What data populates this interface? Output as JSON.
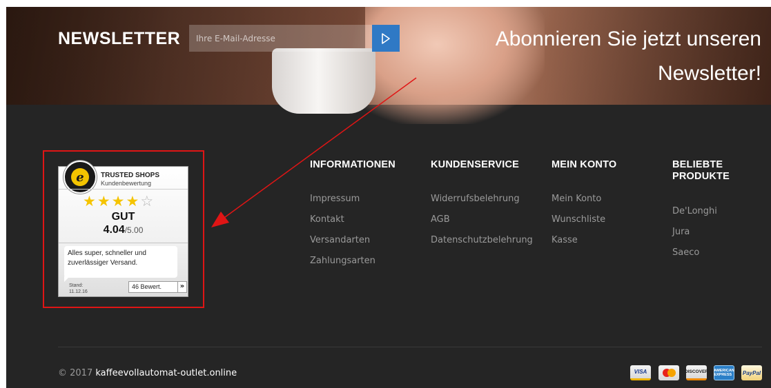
{
  "newsletter": {
    "title": "NEWSLETTER",
    "email_placeholder": "Ihre E-Mail-Adresse",
    "slogan": "Abonnieren Sie jetzt unseren Newsletter!"
  },
  "trusted_shops": {
    "brand": "TRUSTED SHOPS",
    "subtitle": "Kundenbewertung",
    "seal_letter": "e",
    "stars_filled": 4,
    "stars_total": 5,
    "grade": "GUT",
    "score": "4.04",
    "score_max": "/5.00",
    "review_text": "Alles super, schneller und zuverlässiger Versand.",
    "stand_label": "Stand:",
    "stand_date": "11.12.16",
    "review_count": "46 Bewert.",
    "next_icon": "double-chevron-right-icon"
  },
  "footer": {
    "columns": [
      {
        "title": "INFORMATIONEN",
        "links": [
          "Impressum",
          "Kontakt",
          "Versandarten",
          "Zahlungsarten"
        ]
      },
      {
        "title": "KUNDENSERVICE",
        "links": [
          "Widerrufsbelehrung",
          "AGB",
          "Datenschutzbelehrung"
        ]
      },
      {
        "title": "MEIN KONTO",
        "links": [
          "Mein Konto",
          "Wunschliste",
          "Kasse"
        ]
      },
      {
        "title": "BELIEBTE PRODUKTE",
        "links": [
          "De'Longhi",
          "Jura",
          "Saeco"
        ]
      }
    ],
    "copyright_prefix": "© 2017",
    "copyright_site": "kaffeevollautomat-outlet.online",
    "payment_methods": [
      "VISA",
      "MasterCard",
      "DISCOVER",
      "AMERICAN EXPRESS",
      "PayPal"
    ]
  },
  "colors": {
    "accent_button": "#2f79c5",
    "footer_bg": "#252525",
    "annotation_red": "#e01515",
    "star_gold": "#f5c400"
  }
}
